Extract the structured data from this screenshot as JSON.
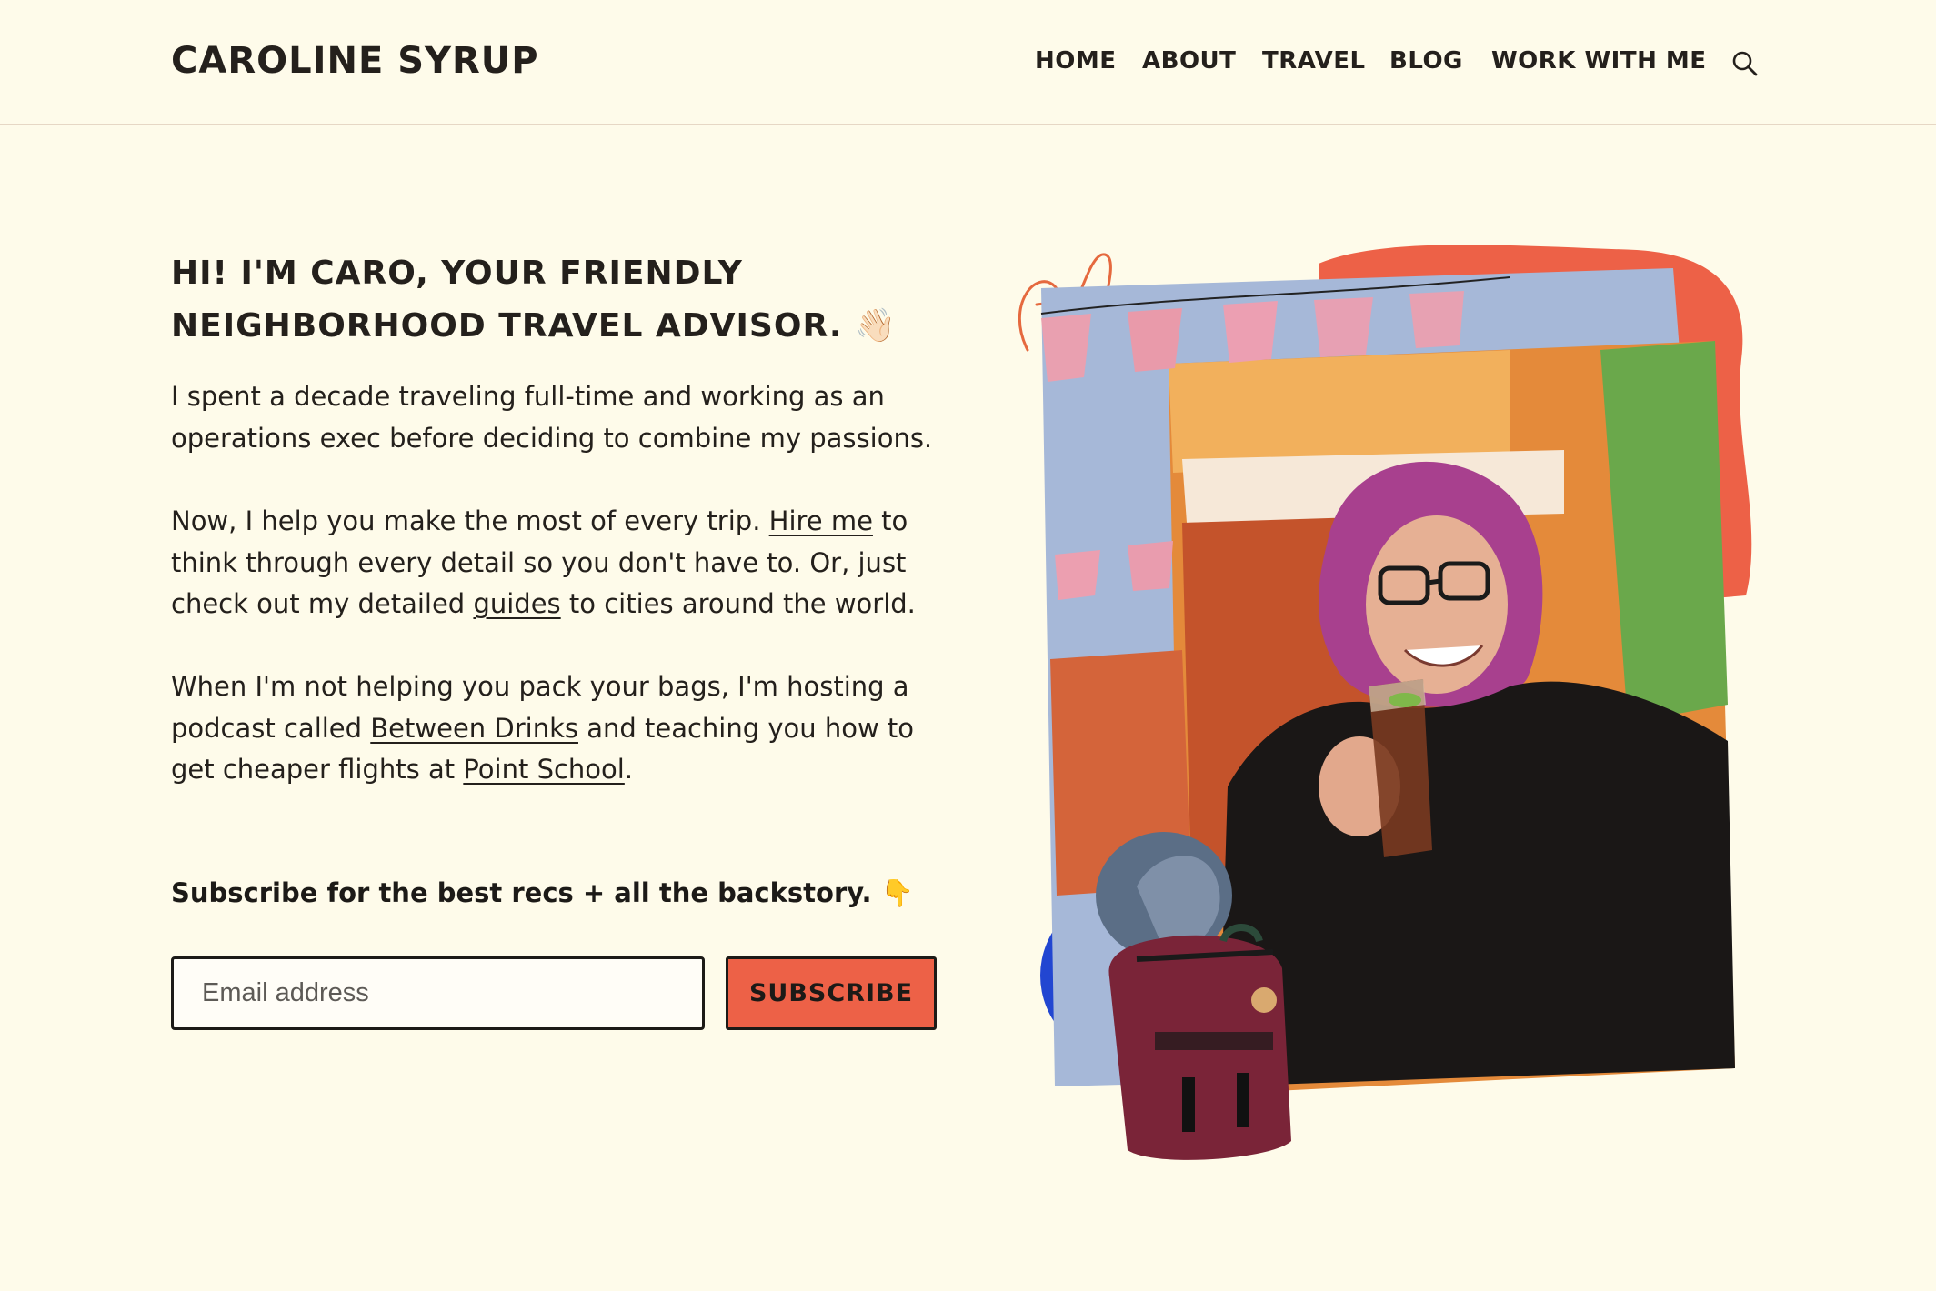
{
  "header": {
    "site_title": "CAROLINE SYRUP",
    "nav": [
      "HOME",
      "ABOUT",
      "TRAVEL",
      "BLOG",
      "WORK WITH ME"
    ],
    "search_icon": "search-icon"
  },
  "intro": {
    "heading_line1": "HI! I'M CARO, YOUR FRIENDLY",
    "heading_line2": "NEIGHBORHOOD TRAVEL ADVISOR.",
    "heading_emoji": "👋🏻",
    "para1": "I spent a decade traveling full-time and working as an operations exec before deciding to combine my passions.",
    "para2_a": "Now, I help you make the most of every trip. ",
    "para2_link1": "Hire me",
    "para2_b": " to think through every detail so you don't have to. Or, just check out my detailed ",
    "para2_link2": "guides",
    "para2_c": " to cities around the world.",
    "para3_a": "When I'm not helping you pack your bags, I'm hosting a podcast called ",
    "para3_link1": "Between Drinks",
    "para3_b": " and teaching you how to get cheaper flights at ",
    "para3_link2": "Point School",
    "para3_c": "."
  },
  "subscribe": {
    "prompt": "Subscribe for the best recs + all the backstory. 👇",
    "email_placeholder": "Email address",
    "button_label": "SUBSCRIBE"
  },
  "colors": {
    "background": "#fefbea",
    "accent_coral": "#ed6147",
    "accent_blue": "#2246d1",
    "text": "#1c1a17"
  }
}
